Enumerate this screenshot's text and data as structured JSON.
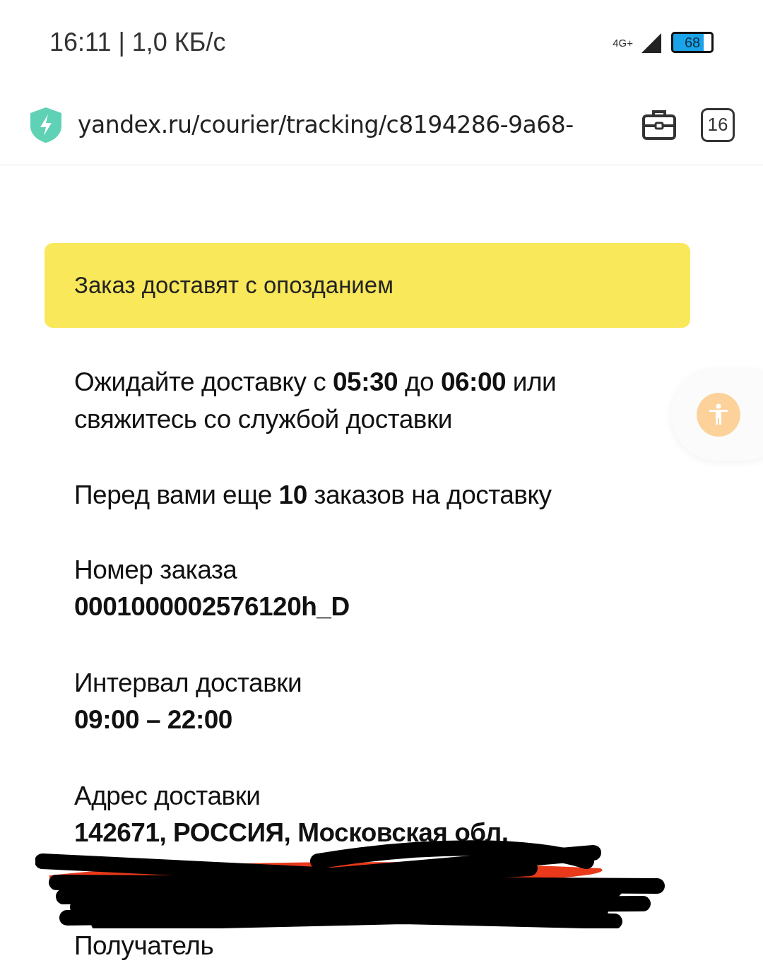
{
  "status_bar": {
    "time_speed": "16:11 | 1,0 КБ/с",
    "network": "4G+",
    "battery": "68"
  },
  "browser": {
    "url": "yandex.ru/courier/tracking/c8194286-9a68-",
    "tab_count": "16"
  },
  "alert": {
    "text": "Заказ доставят с опозданием"
  },
  "messages": [
    "Ожидайте доставку с **05:30** до **06:00** или свяжитесь со службой доставки",
    "Перед вами еще **10** заказов на доставку"
  ],
  "fields": [
    {
      "label": "Номер заказа",
      "value": "0001000002576120h_D",
      "redacted": false
    },
    {
      "label": "Интервал доставки",
      "value": "09:00 – 22:00",
      "redacted": false
    },
    {
      "label": "Адрес доставки",
      "value": "142671, РОССИЯ, Московская обл,",
      "redacted": true
    },
    {
      "label": "Получатель",
      "redacted": false
    }
  ]
}
